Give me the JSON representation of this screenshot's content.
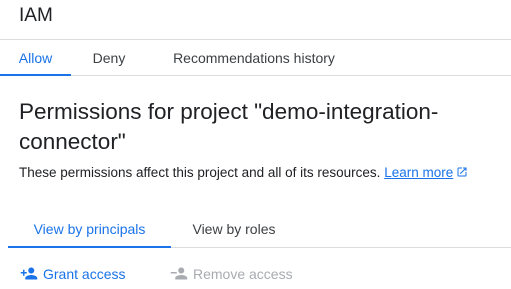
{
  "header": {
    "title": "IAM"
  },
  "tabs": [
    {
      "label": "Allow",
      "active": true
    },
    {
      "label": "Deny",
      "active": false
    },
    {
      "label": "Recommendations history",
      "active": false
    }
  ],
  "main": {
    "heading": "Permissions for project \"demo-integration-connector\"",
    "description": "These permissions affect this project and all of its resources.",
    "learn_more_label": "Learn more"
  },
  "view_tabs": [
    {
      "label": "View by principals",
      "active": true
    },
    {
      "label": "View by roles",
      "active": false
    }
  ],
  "actions": {
    "grant_label": "Grant access",
    "remove_label": "Remove access",
    "remove_disabled": true
  },
  "colors": {
    "accent": "#1a73e8",
    "text": "#202124",
    "disabled": "#a8abb0",
    "divider": "#dadce0"
  },
  "icons": {
    "external_link": "open-in-new-icon",
    "grant": "person-add-icon",
    "remove": "person-remove-icon"
  }
}
